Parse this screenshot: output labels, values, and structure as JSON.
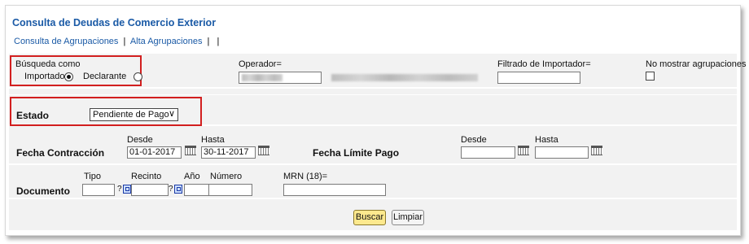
{
  "page": {
    "title": "Consulta de Deudas de Comercio Exterior",
    "nav": {
      "link1": "Consulta de Agrupaciones",
      "sep": "|",
      "link2": "Alta Agrupaciones",
      "sep2": "|",
      "sep3": "|"
    }
  },
  "search": {
    "busqueda_label": "Búsqueda como",
    "importador_label": "Importador",
    "declarante_label": "Declarante",
    "selected": "Importador",
    "operador_label": "Operador=",
    "operador_value": "",
    "filtrado_label": "Filtrado de Importador=",
    "filtrado_value": "",
    "no_mostrar_label": "No mostrar agrupaciones",
    "no_mostrar_checked": false
  },
  "estado": {
    "label": "Estado",
    "selected": "Pendiente de Pago",
    "arrow": "∨"
  },
  "fecha_contraccion": {
    "label": "Fecha Contracción",
    "desde_label": "Desde",
    "desde_value": "01-01-2017",
    "hasta_label": "Hasta",
    "hasta_value": "30-11-2017"
  },
  "fecha_limite": {
    "label": "Fecha Límite Pago",
    "desde_label": "Desde",
    "desde_value": "",
    "hasta_label": "Hasta",
    "hasta_value": ""
  },
  "documento": {
    "label": "Documento",
    "tipo_label": "Tipo",
    "recinto_label": "Recinto",
    "anio_label": "Año",
    "numero_label": "Número",
    "mrn_label": "MRN (18)=",
    "help_glyph": "?"
  },
  "actions": {
    "buscar": "Buscar",
    "limpiar": "Limpiar"
  },
  "colors": {
    "accent": "#1a5aa6",
    "highlight": "#d21f1f",
    "primary_button": "#fde98e"
  }
}
